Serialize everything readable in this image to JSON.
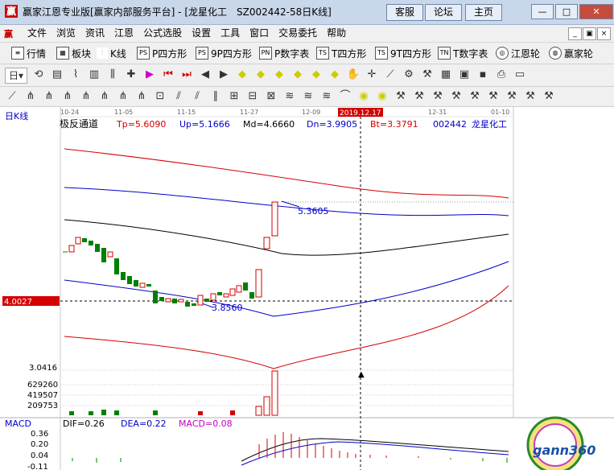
{
  "window": {
    "title": "赢家江恩专业版[赢家内部服务平台] - [龙星化工　SZ002442-58日K线]",
    "buttons": [
      "客服",
      "论坛",
      "主页"
    ],
    "controls": {
      "minimize": "—",
      "restore": "□",
      "close": "✕"
    }
  },
  "menu": [
    "文件",
    "浏览",
    "资讯",
    "江恩",
    "公式选股",
    "设置",
    "工具",
    "窗口",
    "交易委托",
    "帮助"
  ],
  "mdi_controls": [
    "_",
    "▣",
    "×"
  ],
  "toolbar1": [
    {
      "icon": "list-icon",
      "label": "行情"
    },
    {
      "icon": "grid-icon",
      "label": "板块"
    },
    {
      "icon": "kline-icon",
      "label": "K线"
    },
    {
      "icon": "ps-icon",
      "glyph": "PS",
      "label": "P四方形"
    },
    {
      "icon": "ps-icon",
      "glyph": "PS",
      "label": "9P四方形"
    },
    {
      "icon": "ps-icon",
      "glyph": "PN",
      "label": "P数字表"
    },
    {
      "icon": "ts-icon",
      "glyph": "TS",
      "label": "T四方形"
    },
    {
      "icon": "ts-icon",
      "glyph": "TS",
      "label": "9T四方形"
    },
    {
      "icon": "tn-icon",
      "glyph": "TN",
      "label": "T数字表"
    },
    {
      "icon": "wheel-icon",
      "glyph": "◎",
      "label": "江恩轮"
    },
    {
      "icon": "wheel-icon",
      "glyph": "◍",
      "label": "赢家轮"
    }
  ],
  "period_label": "日",
  "chart": {
    "panel_label": "日K线",
    "indicator_name": "极反通道",
    "readouts": [
      {
        "label": "Tp=5.6090",
        "color": "#d40000"
      },
      {
        "label": "Up=5.1666",
        "color": "#0000c8"
      },
      {
        "label": "Md=4.6660",
        "color": "#000000"
      },
      {
        "label": "Dn=3.9905",
        "color": "#0000c8"
      },
      {
        "label": "Bt=3.3791",
        "color": "#d40000"
      }
    ],
    "stock_code": "002442",
    "stock_name": "龙星化工",
    "dates": [
      "10-24",
      "11-05",
      "11-15",
      "11-27",
      "12-09",
      "12-31",
      "01-10"
    ],
    "highlight_date": "2019.12.17",
    "price_axis_label": "4.0027",
    "annotation_high": "5.3605",
    "annotation_low": "3.8560",
    "volume_labels": [
      "3.0416",
      "629260",
      "419507",
      "209753"
    ],
    "macd": {
      "name": "MACD",
      "dif": "DIF=0.26",
      "dea": "DEA=0.22",
      "macd": "MACD=0.08",
      "axis": [
        "0.36",
        "0.20",
        "0.04",
        "-0.11"
      ]
    }
  },
  "logo": "gann360",
  "colors": {
    "red": "#d40000",
    "blue": "#0000c8",
    "green": "#008000",
    "black": "#000000"
  }
}
